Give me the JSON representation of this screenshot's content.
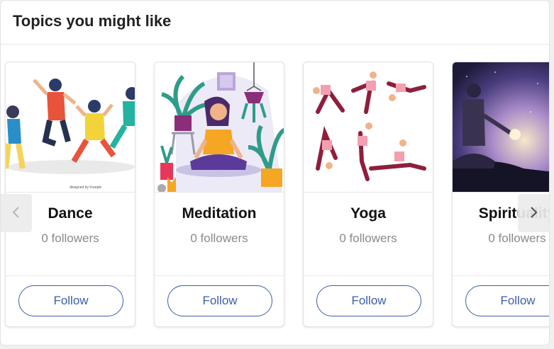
{
  "header": {
    "title": "Topics you might like"
  },
  "cards": [
    {
      "name": "Dance",
      "followers": "0 followers",
      "follow_label": "Follow",
      "image_caption": "designed by Freepik"
    },
    {
      "name": "Meditation",
      "followers": "0 followers",
      "follow_label": "Follow"
    },
    {
      "name": "Yoga",
      "followers": "0 followers",
      "follow_label": "Follow"
    },
    {
      "name": "Spirituality",
      "followers": "0 followers",
      "follow_label": "Follow"
    }
  ],
  "nav": {
    "prev_icon": "chevron-left-icon",
    "next_icon": "chevron-right-icon"
  },
  "colors": {
    "accent": "#3b5ea8",
    "title_text": "#222222",
    "muted_text": "#8a8a8a"
  }
}
